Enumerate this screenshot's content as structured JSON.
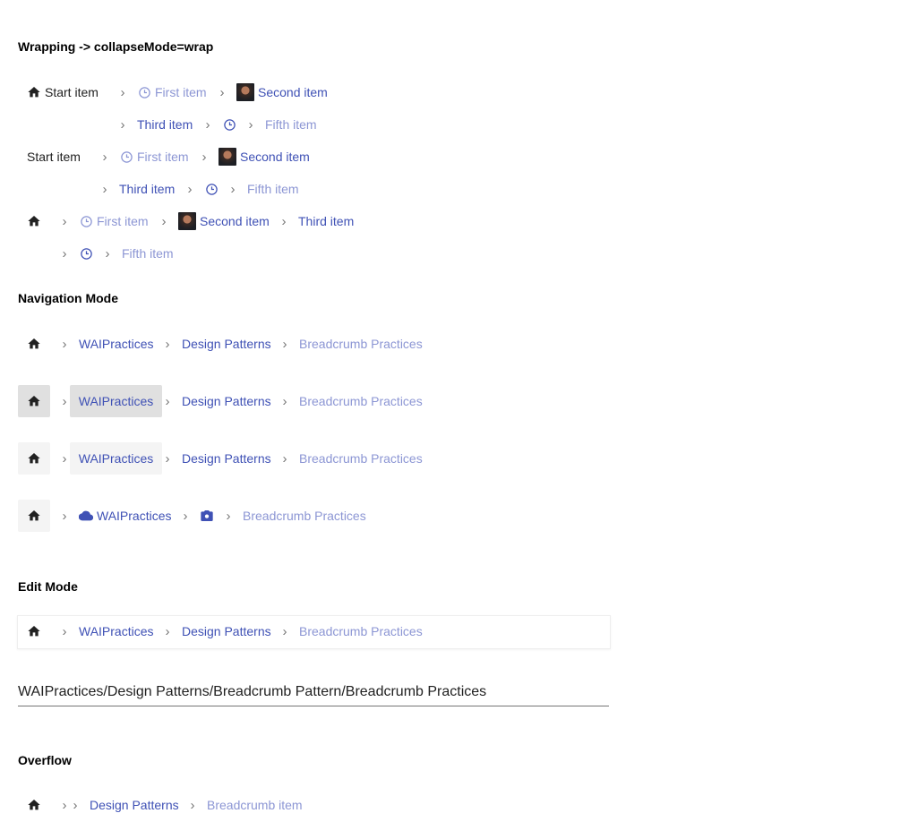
{
  "headings": {
    "wrap": "Wrapping -> collapseMode=wrap",
    "nav": "Navigation Mode",
    "edit": "Edit Mode",
    "overflow": "Overflow"
  },
  "wrap": {
    "start": "Start item",
    "first": "First item",
    "second": "Second item",
    "third": "Third item",
    "fifth": "Fifth item"
  },
  "nav": {
    "wai": "WAIPractices",
    "design": "Design Patterns",
    "current": "Breadcrumb Practices"
  },
  "edit": {
    "path_value": "WAIPractices/Design Patterns/Breadcrumb Pattern/Breadcrumb Practices"
  },
  "overflow": {
    "design": "Design Patterns",
    "current": "Breadcrumb item"
  },
  "separator": "›",
  "colors": {
    "link": "#3f51b5",
    "disabled": "#8c96d4",
    "separator": "#777777"
  }
}
